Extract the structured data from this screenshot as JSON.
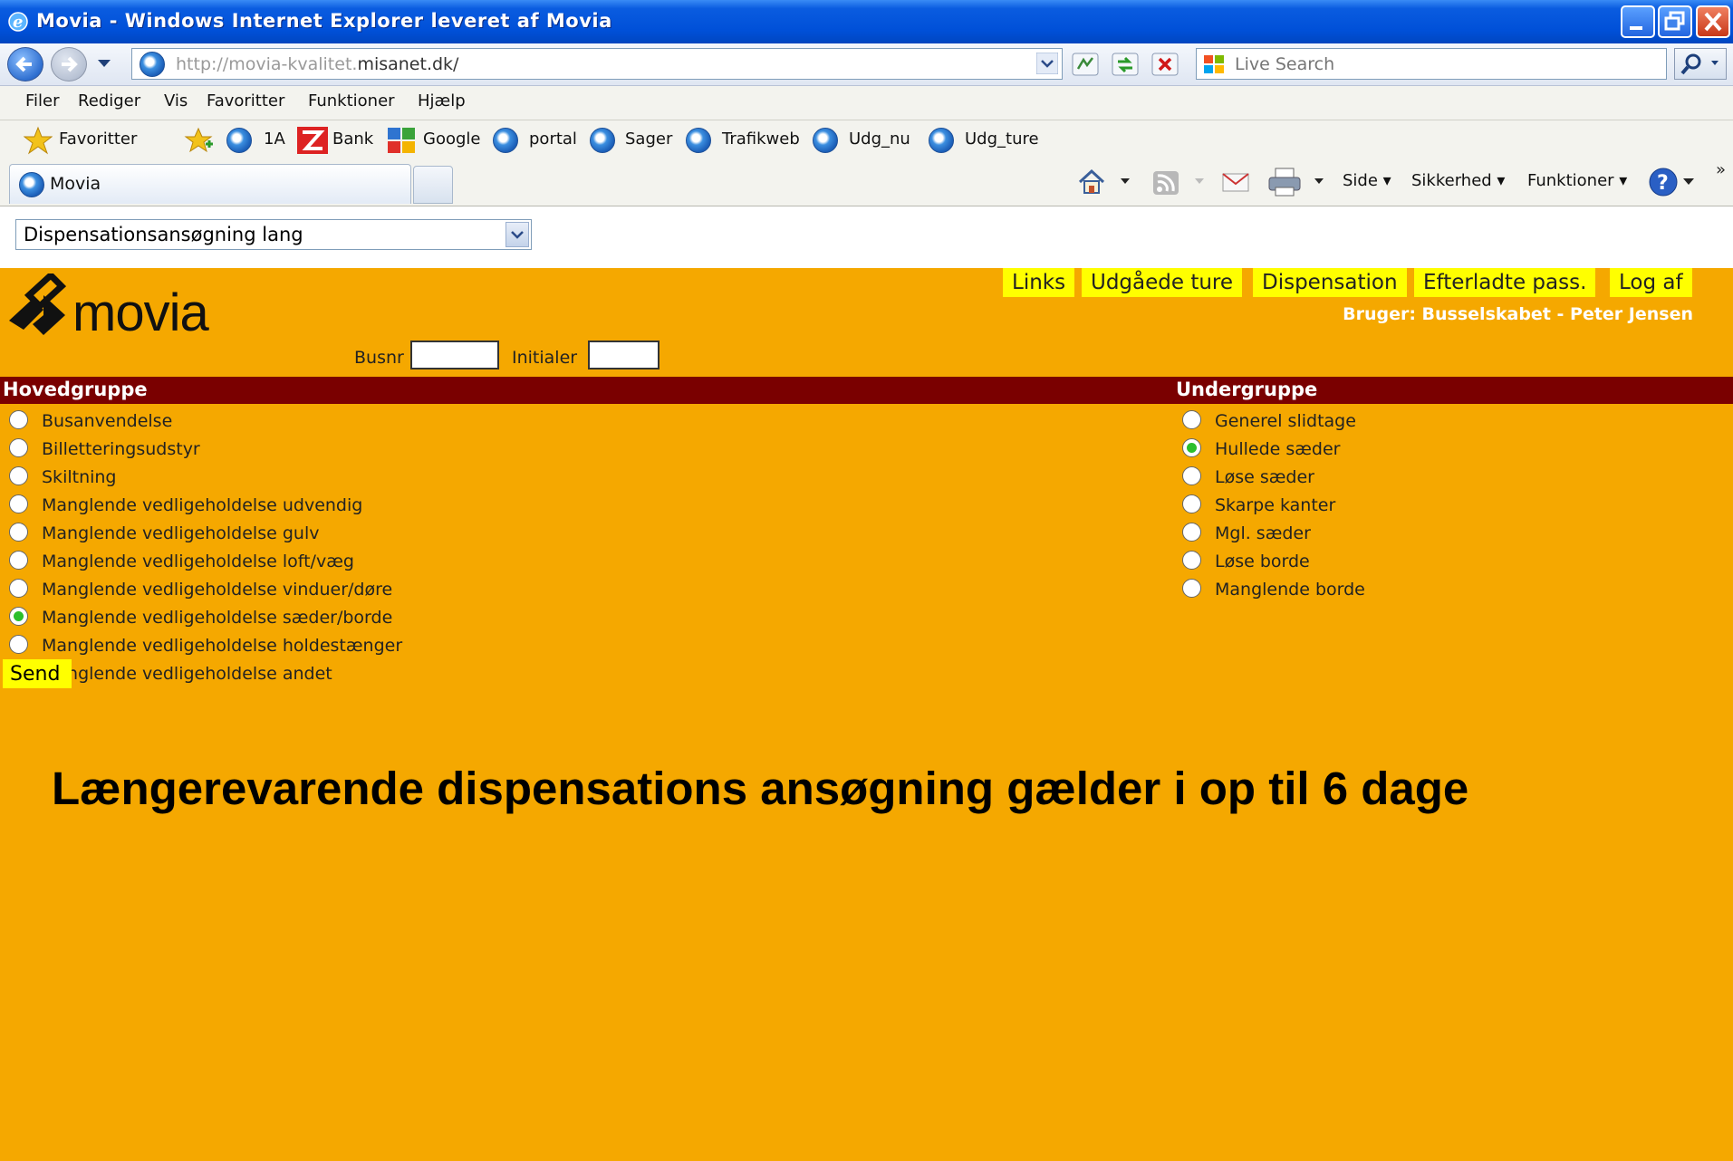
{
  "window": {
    "title": "Movia - Windows Internet Explorer leveret af Movia"
  },
  "address": {
    "url_prefix": "http://movia-kvalitet.",
    "url_domain": "misanet.dk/",
    "search_placeholder": "Live Search"
  },
  "menu": {
    "items": [
      "Filer",
      "Rediger",
      "Vis",
      "Favoritter",
      "Funktioner",
      "Hjælp"
    ]
  },
  "favorites": {
    "label": "Favoritter",
    "links": [
      "1A",
      "Bank",
      "Google",
      "portal",
      "Sager",
      "Trafikweb",
      "Udg_nu",
      "Udg_ture"
    ]
  },
  "tabs": {
    "active": "Movia"
  },
  "command_bar": {
    "side": "Side",
    "security": "Sikkerhed",
    "tools": "Funktioner"
  },
  "page": {
    "form_select": "Dispensationsansøgning lang",
    "logo_text": "movia",
    "top_links": [
      "Links",
      "Udgåede ture",
      "Dispensation",
      "Efterladte pass.",
      "Log af"
    ],
    "user_line": "Bruger: Busselskabet - Peter Jensen",
    "busnr_label": "Busnr",
    "initials_label": "Initialer",
    "main_group_header": "Hovedgruppe",
    "sub_group_header": "Undergruppe",
    "main_groups": [
      {
        "label": "Busanvendelse",
        "selected": false
      },
      {
        "label": "Billetteringsudstyr",
        "selected": false
      },
      {
        "label": "Skiltning",
        "selected": false
      },
      {
        "label": "Manglende vedligeholdelse udvendig",
        "selected": false
      },
      {
        "label": "Manglende vedligeholdelse gulv",
        "selected": false
      },
      {
        "label": "Manglende vedligeholdelse loft/væg",
        "selected": false
      },
      {
        "label": "Manglende vedligeholdelse vinduer/døre",
        "selected": false
      },
      {
        "label": "Manglende vedligeholdelse sæder/borde",
        "selected": true
      },
      {
        "label": "Manglende vedligeholdelse holdestænger",
        "selected": false
      },
      {
        "label": "Manglende vedligeholdelse andet",
        "selected": false
      }
    ],
    "sub_groups": [
      {
        "label": "Generel slidtage",
        "selected": false
      },
      {
        "label": "Hullede sæder",
        "selected": true
      },
      {
        "label": "Løse sæder",
        "selected": false
      },
      {
        "label": "Skarpe kanter",
        "selected": false
      },
      {
        "label": "Mgl. sæder",
        "selected": false
      },
      {
        "label": "Løse borde",
        "selected": false
      },
      {
        "label": "Manglende borde",
        "selected": false
      }
    ],
    "send_label": "Send",
    "note": "Længerevarende dispensations ansøgning gælder i op til 6 dage"
  },
  "colors": {
    "page_background": "#f5a800",
    "group_bar": "#7a0000",
    "link_highlight": "#ffff00",
    "radio_selected": "#2cbf2c"
  }
}
